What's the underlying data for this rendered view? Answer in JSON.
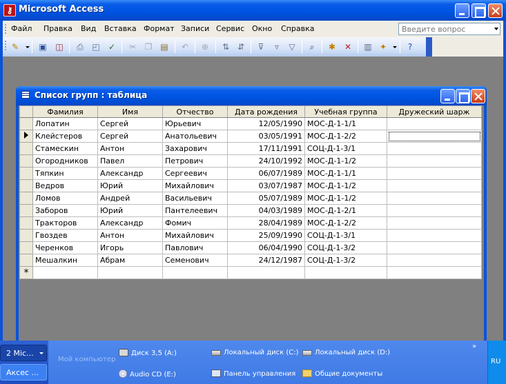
{
  "window": {
    "title": "Microsoft Access",
    "icon": "access-key-icon",
    "accent": "#0054E3"
  },
  "menu": {
    "items": [
      "Файл",
      "Правка",
      "Вид",
      "Вставка",
      "Формат",
      "Записи",
      "Сервис",
      "Окно",
      "Справка"
    ],
    "ask_placeholder": "Введите вопрос"
  },
  "toolbar": {
    "icons": [
      "view-design-icon",
      "save-icon",
      "search-file-icon",
      "print-icon",
      "print-preview-icon",
      "spelling-icon",
      "cut-icon",
      "copy-icon",
      "paste-icon",
      "undo-icon",
      "hyperlink-icon",
      "sort-ascending-icon",
      "sort-descending-icon",
      "filter-by-selection-icon",
      "filter-by-form-icon",
      "apply-filter-icon",
      "find-icon",
      "new-record-icon",
      "delete-record-icon",
      "database-window-icon",
      "new-object-icon",
      "help-icon"
    ]
  },
  "child": {
    "title": "Список групп : таблица",
    "columns": [
      "Фамилия",
      "Имя",
      "Отчество",
      "Дата рождения",
      "Учебная группа",
      "Дружеский шарж"
    ],
    "rows": [
      [
        "Лопатин",
        "Сергей",
        "Юрьевич",
        "12/05/1990",
        "МОС-Д-1-1/1",
        ""
      ],
      [
        "Клейстеров",
        "Сергей",
        "Анатольевич",
        "03/05/1991",
        "МОС-Д-1-2/2",
        ""
      ],
      [
        "Стамескин",
        "Антон",
        "Захарович",
        "17/11/1991",
        "СОЦ-Д-1-3/1",
        ""
      ],
      [
        "Огородников",
        "Павел",
        "Петрович",
        "24/10/1992",
        "МОС-Д-1-1/2",
        ""
      ],
      [
        "Тяпкин",
        "Александр",
        "Сергеевич",
        "06/07/1989",
        "МОС-Д-1-1/1",
        ""
      ],
      [
        "Ведров",
        "Юрий",
        "Михайлович",
        "03/07/1987",
        "МОС-Д-1-1/2",
        ""
      ],
      [
        "Ломов",
        "Андрей",
        "Васильевич",
        "05/07/1989",
        "МОС-Д-1-1/2",
        ""
      ],
      [
        "Заборов",
        "Юрий",
        "Пантелеевич",
        "04/03/1989",
        "МОС-Д-1-2/1",
        ""
      ],
      [
        "Тракторов",
        "Александр",
        "Фомич",
        "28/04/1989",
        "МОС-Д-1-2/2",
        ""
      ],
      [
        "Гвоздев",
        "Антон",
        "Михайлович",
        "25/09/1990",
        "СОЦ-Д-1-3/1",
        ""
      ],
      [
        "Черенков",
        "Игорь",
        "Павлович",
        "06/04/1990",
        "СОЦ-Д-1-3/2",
        ""
      ],
      [
        "Мешалкин",
        "Абрам",
        "Семенович",
        "24/12/1987",
        "СОЦ-Д-1-3/2",
        ""
      ]
    ],
    "current_row": 1,
    "new_row_marker": "*"
  },
  "taskbar": {
    "task_a": "2 Mic...",
    "task_b": "Аксес ...",
    "my_computer": "Мой компьютер",
    "links": {
      "floppy": "Диск 3,5 (A:)",
      "cd": "Audio CD (E:)",
      "disk_c": "Локальный диск (C:)",
      "control_panel": "Панель управления",
      "disk_d": "Локальный диск (D:)",
      "shared_docs": "Общие документы"
    },
    "chevron": "»",
    "lang": "RU"
  }
}
